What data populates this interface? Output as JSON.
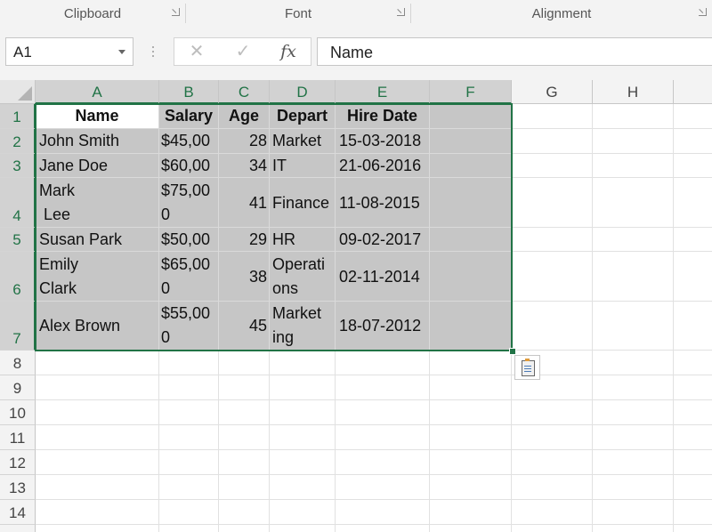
{
  "ribbon": {
    "groups": [
      {
        "label": "Clipboard"
      },
      {
        "label": "Font"
      },
      {
        "label": "Alignment"
      }
    ]
  },
  "formula_bar": {
    "name_box": "A1",
    "cancel_glyph": "✕",
    "enter_glyph": "✓",
    "fx_label": "fx",
    "value": "Name"
  },
  "columns": [
    "A",
    "B",
    "C",
    "D",
    "E",
    "F",
    "G",
    "H"
  ],
  "rows": [
    "1",
    "2",
    "3",
    "4",
    "5",
    "6",
    "7",
    "8",
    "9",
    "10",
    "11",
    "12",
    "13",
    "14"
  ],
  "table": {
    "headers": [
      "Name",
      "Salary",
      "Age",
      "Depart",
      "Hire Date"
    ],
    "rows": [
      [
        "John Smith",
        "$45,00",
        "28",
        "Market",
        "15-03-2018"
      ],
      [
        "Jane Doe",
        "$60,00",
        "34",
        "IT",
        "21-06-2016"
      ],
      [
        "Mark\n Lee",
        "$75,00\n0",
        "41",
        "Finance",
        "11-08-2015"
      ],
      [
        "Susan Park",
        "$50,00",
        "29",
        "HR",
        "09-02-2017"
      ],
      [
        "Emily\nClark",
        "$65,00\n0",
        "38",
        "Operati\nons",
        "02-11-2014"
      ],
      [
        "Alex Brown",
        "$55,00\n0",
        "45",
        "Market\ning",
        "18-07-2012"
      ]
    ]
  },
  "selection": "A1:F7",
  "colors": {
    "accent": "#217346",
    "selection_fill": "#c6c6c6"
  }
}
